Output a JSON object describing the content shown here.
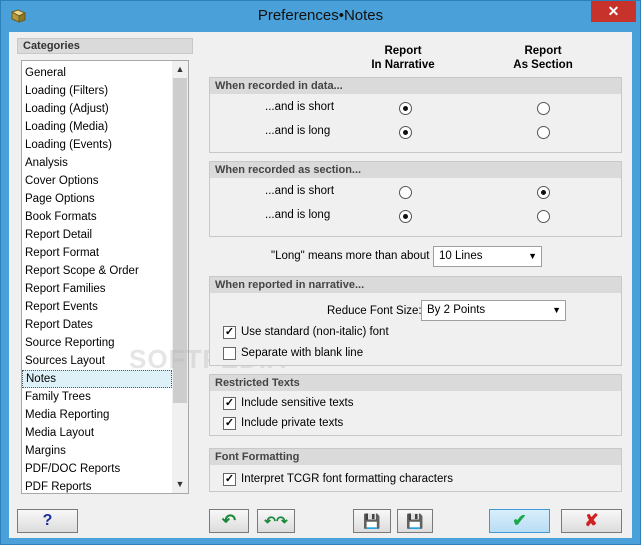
{
  "window": {
    "title": "Preferences•Notes",
    "close_label": "✕"
  },
  "categories": {
    "header": "Categories",
    "items": [
      "General",
      "Loading (Filters)",
      "Loading (Adjust)",
      "Loading (Media)",
      "Loading (Events)",
      "Analysis",
      "Cover Options",
      "Page Options",
      "Book Formats",
      "Report Detail",
      "Report Format",
      "Report Scope & Order",
      "Report Families",
      "Report Events",
      "Report Dates",
      "Source Reporting",
      "Sources Layout",
      "Notes",
      "Family Trees",
      "Media Reporting",
      "Media Layout",
      "Margins",
      "PDF/DOC Reports",
      "PDF Reports"
    ],
    "selected": "Notes"
  },
  "watermark": "SOFTPEDIA",
  "columns": {
    "narrative_line1": "Report",
    "narrative_line2": "In Narrative",
    "section_line1": "Report",
    "section_line2": "As Section"
  },
  "groups": {
    "in_data": {
      "title": "When recorded in data...",
      "short": "...and is short",
      "long": "...and is long"
    },
    "as_section": {
      "title": "When recorded as section...",
      "short": "...and is short",
      "long": "...and is long"
    }
  },
  "long_means": {
    "label": "\"Long\" means more than about",
    "value": "10 Lines"
  },
  "narrative": {
    "title": "When reported in narrative...",
    "reduce_label": "Reduce Font Size:",
    "reduce_value": "By 2 Points",
    "use_standard": "Use standard (non-italic) font",
    "separate": "Separate with blank line"
  },
  "restricted": {
    "title": "Restricted Texts",
    "sensitive": "Include sensitive texts",
    "private": "Include private texts"
  },
  "font_formatting": {
    "title": "Font Formatting",
    "interpret": "Interpret TCGR font formatting characters"
  },
  "buttons": {
    "help": "?",
    "undo": "↶",
    "undo_all": "↶↷",
    "save": "💾",
    "load": "💾",
    "ok": "✔",
    "cancel": "✘"
  },
  "colors": {
    "accent": "#4aa0d8",
    "ok_green": "#1aa84a",
    "cancel_red": "#d02020"
  }
}
